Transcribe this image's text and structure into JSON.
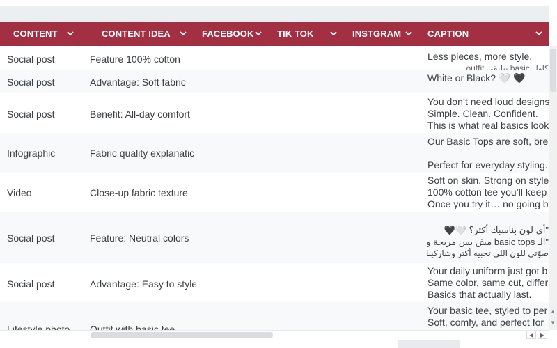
{
  "columns": [
    {
      "label": "CONTENT"
    },
    {
      "label": "CONTENT IDEA"
    },
    {
      "label": "FACEBOOK"
    },
    {
      "label": "TIK TOK"
    },
    {
      "label": "INSTGRAM"
    },
    {
      "label": "CAPTION"
    }
  ],
  "rows": [
    {
      "content": "Social post",
      "idea": "Feature 100% cotton",
      "caption": [
        "Less pieces, more style.",
        "كاول basic بيلبقي outfit..."
      ]
    },
    {
      "content": "Social post",
      "idea": "Advantage: Soft fabric",
      "caption": [
        "White or Black? 🤍 🖤"
      ]
    },
    {
      "content": "Social post",
      "idea": "Benefit: All-day comfort",
      "caption": [
        "You don’t need loud designs",
        "Simple. Clean. Confident.",
        "This is what real basics look"
      ]
    },
    {
      "content": "Infographic",
      "idea": "Fabric quality explanatic",
      "caption": [
        "Our Basic Tops are soft, bre",
        "",
        "Perfect for everyday styling."
      ]
    },
    {
      "content": "Video",
      "idea": "Close-up fabric texture",
      "caption": [
        "Soft on skin. Strong on style",
        "100% cotton tee you’ll keep",
        "Once you try it… no going ba"
      ]
    },
    {
      "content": "Social post",
      "idea": "Feature: Neutral colors",
      "caption": [
        "\"أي لون بناسبك أكتر؟ 🤍🖤",
        "\"الـ basic tops مش بس مريحة وسها",
        "صوّتي للون اللي تحبيه أكتر وشاركينا را"
      ]
    },
    {
      "content": "Social post",
      "idea": "Advantage: Easy to style",
      "caption": [
        "Your daily uniform just got b",
        "Same color, same cut, differ",
        "Basics that actually last."
      ]
    },
    {
      "content": "Lifestyle photo",
      "idea": "Outfit with basic tee",
      "caption": [
        "Your basic tee, styled to per",
        "Soft, comfy, and perfect for"
      ]
    }
  ],
  "icons": {
    "header_dropdown": "chevron-down-icon",
    "scroll_up": "arrow-up-icon",
    "scroll_down": "arrow-down-icon",
    "scroll_left": "arrow-left-icon",
    "scroll_right": "arrow-right-icon"
  },
  "colors": {
    "header_bg": "#a33042",
    "header_text": "#ffffff",
    "row_alt": "#f8f9fa",
    "text": "#3c4043"
  }
}
